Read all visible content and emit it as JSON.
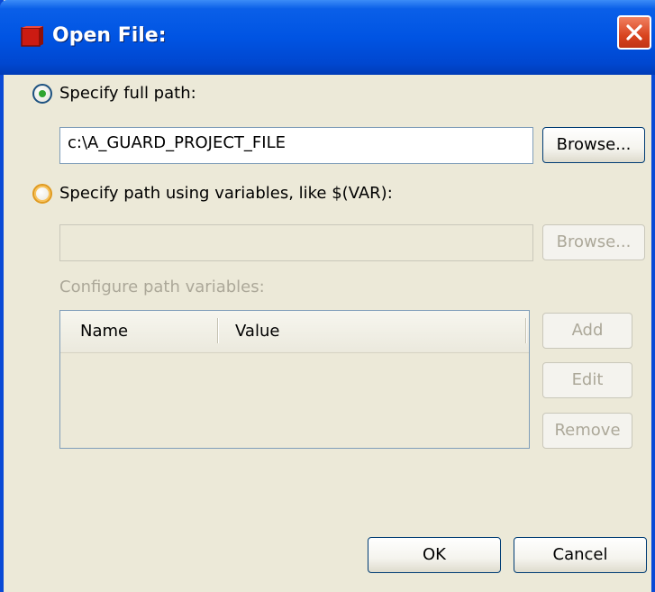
{
  "window": {
    "title": "Open File:"
  },
  "option_full_path": {
    "label": "Specify full path:",
    "selected": true,
    "path_value": "c:\\A_GUARD_PROJECT_FILE",
    "browse_label": "Browse..."
  },
  "option_variables": {
    "label": "Specify path using variables, like $(VAR):",
    "selected": false,
    "path_value": "",
    "browse_label": "Browse..."
  },
  "path_variables": {
    "label": "Configure path variables:",
    "columns": [
      "Name",
      "Value"
    ],
    "rows": [],
    "add_label": "Add",
    "edit_label": "Edit",
    "remove_label": "Remove"
  },
  "footer": {
    "ok_label": "OK",
    "cancel_label": "Cancel"
  },
  "colors": {
    "titlebar": "#0054e3",
    "dialog_background": "#ece9d8",
    "close_button": "#d9441f",
    "disabled_text": "#aca899"
  }
}
